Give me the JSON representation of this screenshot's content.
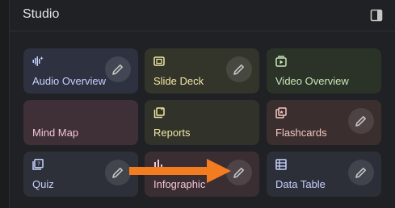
{
  "studio": {
    "title": "Studio"
  },
  "cards": [
    {
      "label": "Audio Overview",
      "icon": "audio-waveform-icon",
      "bg": "#2e3140",
      "fg": "#c7d2fe",
      "editable": true
    },
    {
      "label": "Slide Deck",
      "icon": "slides-icon",
      "bg": "#33342a",
      "fg": "#f3e8a6",
      "editable": true
    },
    {
      "label": "Video Overview",
      "icon": "video-icon",
      "bg": "#2b3329",
      "fg": "#c8e6b8",
      "editable": false
    },
    {
      "label": "Mind Map",
      "icon": "",
      "bg": "#3e3036",
      "fg": "#f1c6d6",
      "editable": false
    },
    {
      "label": "Reports",
      "icon": "reports-icon",
      "bg": "#31322a",
      "fg": "#f3e8a6",
      "editable": false
    },
    {
      "label": "Flashcards",
      "icon": "flashcards-icon",
      "bg": "#3a2e2e",
      "fg": "#f4c7c0",
      "editable": true
    },
    {
      "label": "Quiz",
      "icon": "quiz-icon",
      "bg": "#2d3038",
      "fg": "#c7d2fe",
      "editable": true
    },
    {
      "label": "Infographic",
      "icon": "infographic-icon",
      "bg": "#3a2e33",
      "fg": "#f1c6d6",
      "editable": true
    },
    {
      "label": "Data Table",
      "icon": "table-icon",
      "bg": "#2c2f38",
      "fg": "#c7d2fe",
      "editable": true
    }
  ],
  "colors": {
    "accent_arrow": "#f47c20",
    "panel_bg": "#202124",
    "text": "#e3e3e3"
  }
}
